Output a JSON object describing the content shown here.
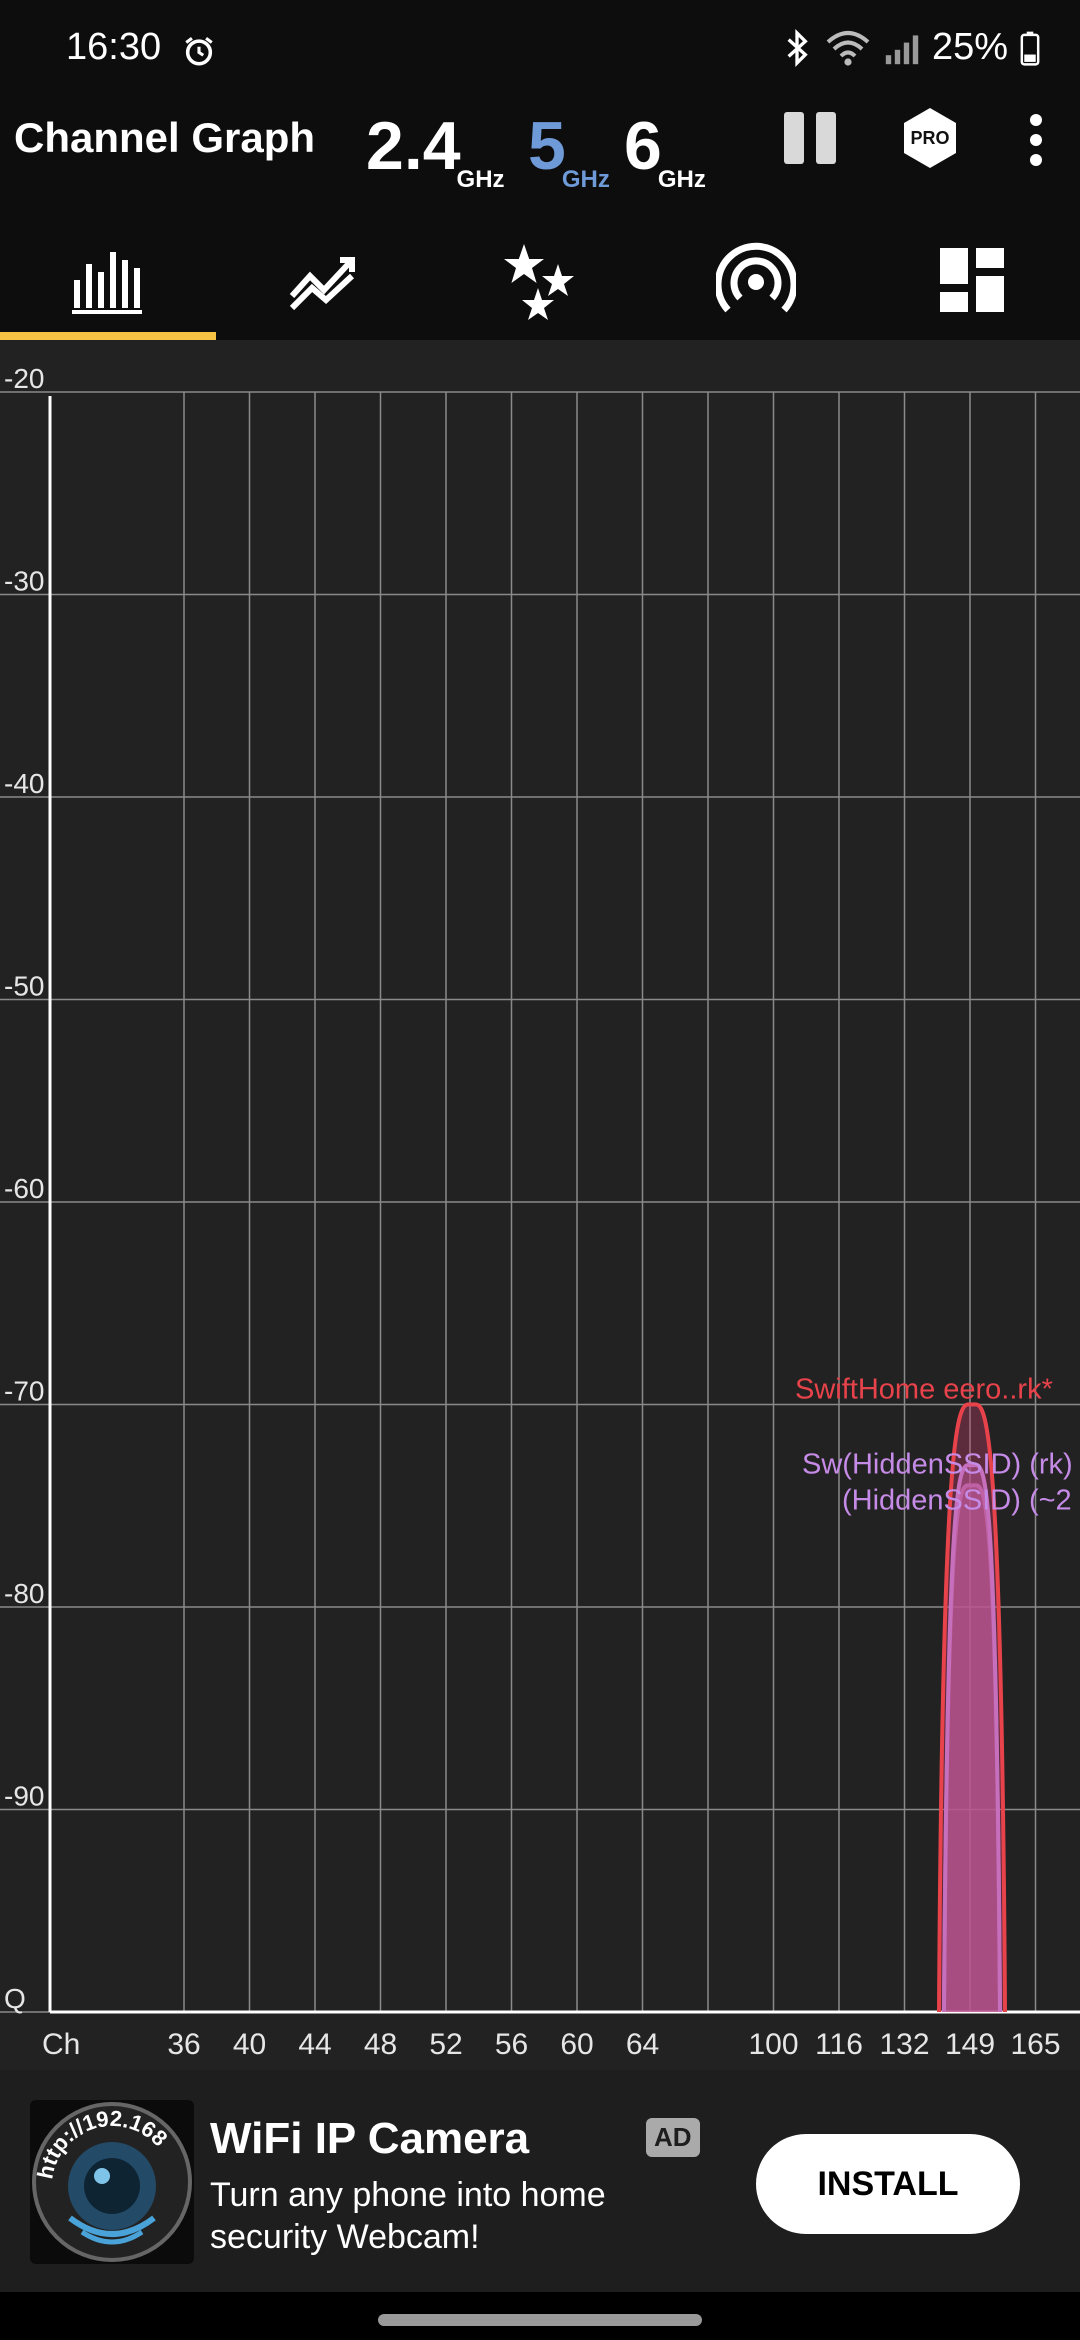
{
  "status_bar": {
    "time": "16:30",
    "battery": "25%",
    "icons": [
      "alarm-icon",
      "bluetooth-icon",
      "wifi-icon",
      "signal-icon",
      "battery-icon"
    ]
  },
  "app_bar": {
    "title": "Channel Graph",
    "bands": [
      {
        "value": "2.4",
        "unit": "GHz",
        "color": "#ffffff"
      },
      {
        "value": "5",
        "unit": "GHz",
        "color": "#6f9ad8",
        "selected": true
      },
      {
        "value": "6",
        "unit": "GHz",
        "color": "#ffffff"
      }
    ],
    "pro_label": "PRO"
  },
  "tabs": [
    {
      "icon": "bar-chart-icon",
      "selected": true
    },
    {
      "icon": "line-graph-icon",
      "selected": false
    },
    {
      "icon": "stars-icon",
      "selected": false
    },
    {
      "icon": "access-point-icon",
      "selected": false
    },
    {
      "icon": "dashboard-icon",
      "selected": false
    }
  ],
  "accent_color": "#f6c344",
  "chart_data": {
    "type": "area",
    "y_ticks": [
      "-20",
      "-30",
      "-40",
      "-50",
      "-60",
      "-70",
      "-80",
      "-90",
      "Q"
    ],
    "ylim": [
      -100,
      -20
    ],
    "x_axis_label": "Ch",
    "x_ticks": [
      "36",
      "40",
      "44",
      "48",
      "52",
      "56",
      "60",
      "64",
      "100",
      "116",
      "132",
      "149",
      "165"
    ],
    "series": [
      {
        "name": "SwiftHome eero..rk*",
        "channel": "149",
        "level": -70,
        "color": "#e8434b"
      },
      {
        "name": "Sw(HiddenSSID) (rk)",
        "channel": "149",
        "level": -73,
        "color": "#c58be6"
      },
      {
        "name": "(HiddenSSID) (~2",
        "channel": "149",
        "level": -74,
        "color": "#c58be6"
      }
    ]
  },
  "ad": {
    "icon_text": "http://192.168",
    "title": "WiFi IP Camera",
    "badge": "AD",
    "description": "Turn any phone into home security Webcam!",
    "button": "INSTALL"
  }
}
